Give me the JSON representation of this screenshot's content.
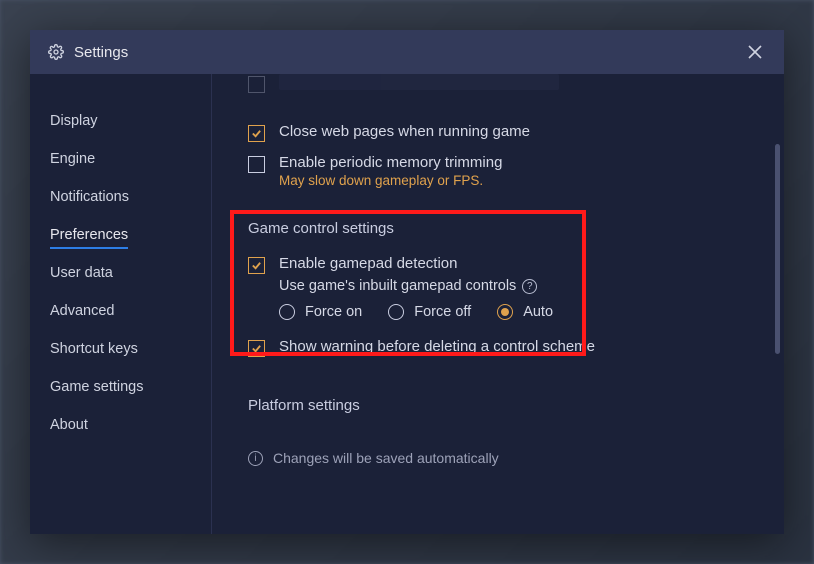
{
  "title": "Settings",
  "sidebar": {
    "items": [
      {
        "label": "Display"
      },
      {
        "label": "Engine"
      },
      {
        "label": "Notifications"
      },
      {
        "label": "Preferences",
        "active": true
      },
      {
        "label": "User data"
      },
      {
        "label": "Advanced"
      },
      {
        "label": "Shortcut keys"
      },
      {
        "label": "Game settings"
      },
      {
        "label": "About"
      }
    ]
  },
  "options": {
    "close_web_pages": "Close web pages when running game",
    "periodic_trim": "Enable periodic memory trimming",
    "periodic_trim_warn": "May slow down gameplay or FPS."
  },
  "game_control": {
    "title": "Game control settings",
    "enable_gamepad": "Enable gamepad detection",
    "use_inbuilt": "Use game's inbuilt gamepad controls",
    "radios": {
      "force_on": "Force on",
      "force_off": "Force off",
      "auto": "Auto"
    },
    "show_warning": "Show warning before deleting a control scheme"
  },
  "platform": {
    "title": "Platform settings"
  },
  "footer": "Changes will be saved automatically"
}
